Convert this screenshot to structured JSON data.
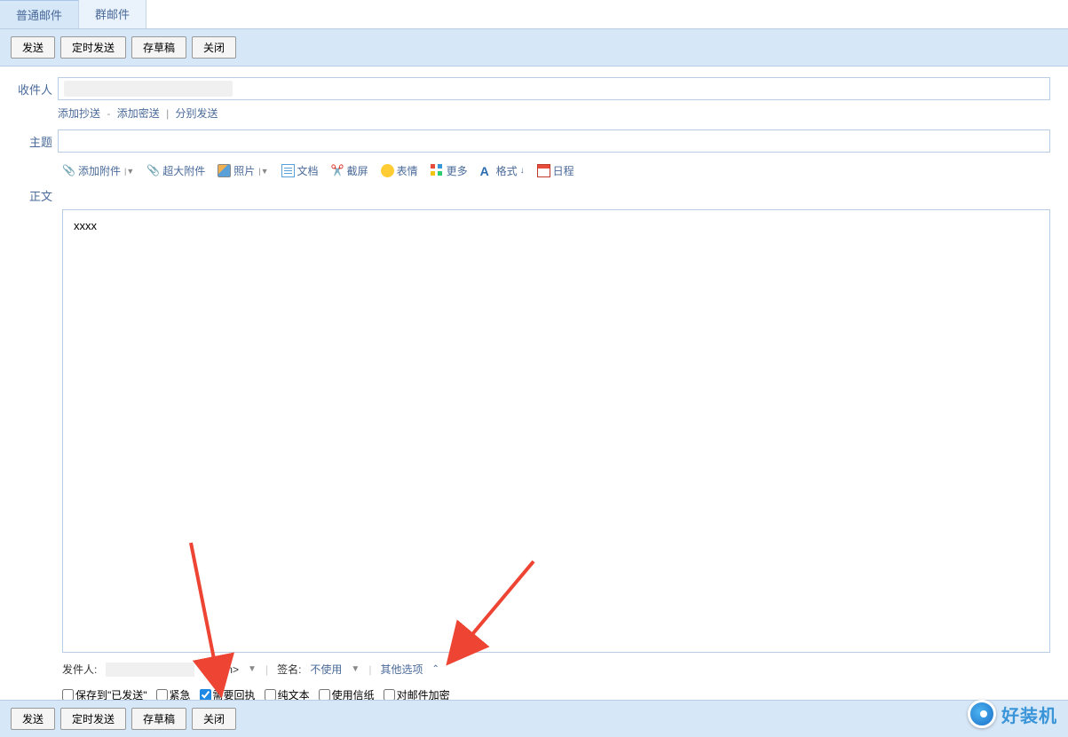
{
  "tabs": {
    "normal": "普通邮件",
    "group": "群邮件"
  },
  "toolbar": {
    "send": "发送",
    "timed_send": "定时发送",
    "draft": "存草稿",
    "close": "关闭"
  },
  "recipient": {
    "label": "收件人",
    "add_cc": "添加抄送",
    "add_bcc": "添加密送",
    "send_separately": "分别发送"
  },
  "subject": {
    "label": "主题"
  },
  "editor_toolbar": {
    "attach": "添加附件",
    "large_attach": "超大附件",
    "photo": "照片",
    "doc": "文档",
    "screenshot": "截屏",
    "emoji": "表情",
    "more": "更多",
    "format": "格式",
    "calendar": "日程"
  },
  "body": {
    "label": "正文",
    "content": "xxxx"
  },
  "footer": {
    "sender_label": "发件人:",
    "sender_suffix": "q.com>",
    "signature_label": "签名:",
    "signature_value": "不使用",
    "other_options": "其他选项"
  },
  "options": {
    "save_sent": "保存到\"已发送\"",
    "urgent": "紧急",
    "receipt": "需要回执",
    "plain_text": "纯文本",
    "stationery": "使用信纸",
    "encrypt": "对邮件加密"
  },
  "watermark": "好装机"
}
